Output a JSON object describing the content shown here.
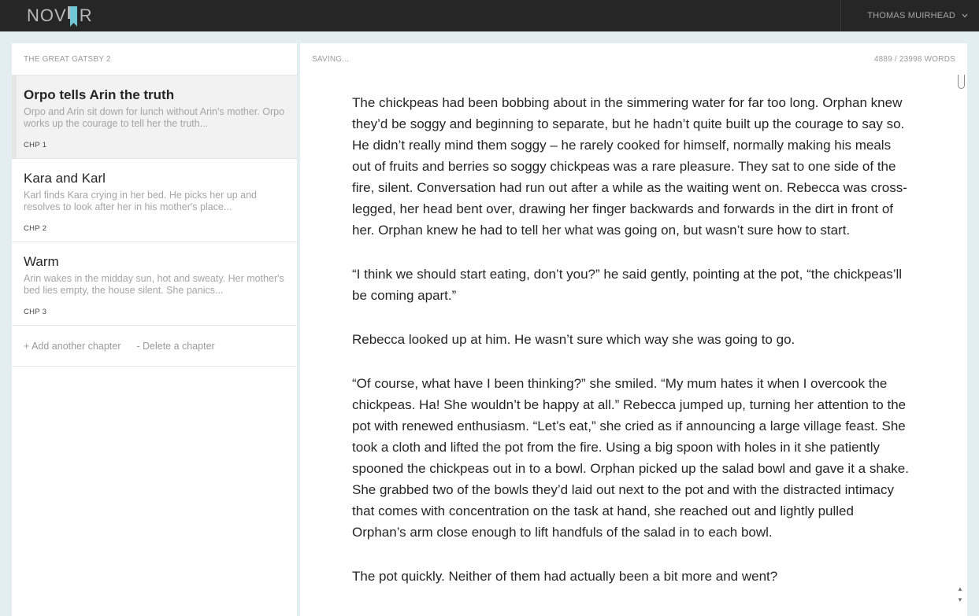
{
  "brand": {
    "logo_left": "NOV",
    "logo_right": "R",
    "accent": "#6fc7d6"
  },
  "user": {
    "name": "THOMAS MUIRHEAD",
    "menu_icon": "chevron-down-icon"
  },
  "sidebar": {
    "book_title": "THE GREAT GATSBY 2",
    "chapters": [
      {
        "title": "Orpo tells Arin the truth",
        "summary": "Orpo and Arin sit down for lunch without Arin's mother. Orpo works up the courage to tell her the truth...",
        "number": "CHP 1"
      },
      {
        "title": "Kara and Karl",
        "summary": "Karl finds Kara crying in her bed. He picks her up and resolves to look after her in his mother's place...",
        "number": "CHP 2"
      },
      {
        "title": "Warm",
        "summary": "Arin wakes in the midday sun, hot and sweaty. Her mother's bed lies empty, the house silent. She panics...",
        "number": "CHP 3"
      }
    ],
    "add_label": "+ Add another chapter",
    "delete_label": "- Delete a chapter"
  },
  "editor": {
    "status": "SAVING...",
    "word_count": "4889 / 23998 WORDS",
    "paragraphs": [
      "The chickpeas had been bobbing about in the simmering water for far too long. Orphan knew they’d be soggy and beginning to separate, but he hadn’t quite built up the courage to say so. He didn’t really mind them soggy – he rarely cooked for himself, normally making his meals out of fruits and berries so soggy chickpeas was a rare pleasure. They sat to one side of the fire, silent. Conversation had run out after a while as the waiting went on. Rebecca was cross-legged, her head bent over, drawing her finger backwards and forwards in the dirt in front of her. Orphan knew he had to tell her what was going on, but wasn’t sure how to start.",
      "“I think we should start eating, don’t you?” he said gently, pointing at the pot, “the chickpeas’ll be coming apart.”",
      "Rebecca looked up at him. He wasn’t sure which way she was going to go.",
      "“Of course, what have I been thinking?” she smiled. “My mum hates it when I overcook the chickpeas. Ha! She wouldn’t be happy at all.” Rebecca jumped up, turning her attention to the pot with renewed enthusiasm. “Let’s eat,” she cried as if announcing a large village feast. She took a cloth and lifted the pot from the fire. Using a big spoon with holes in it she patiently spooned the chickpeas out in to a bowl. Orphan picked up the salad bowl and gave it a shake. She grabbed two of the bowls they’d laid out next to the pot and with the distracted intimacy that comes with concentration on the task at hand, she reached out and lightly pulled Orphan’s arm close enough to lift handfuls of the salad in to each bowl.",
      "The pot quickly. Neither of them had actually been a bit more and went?"
    ]
  }
}
